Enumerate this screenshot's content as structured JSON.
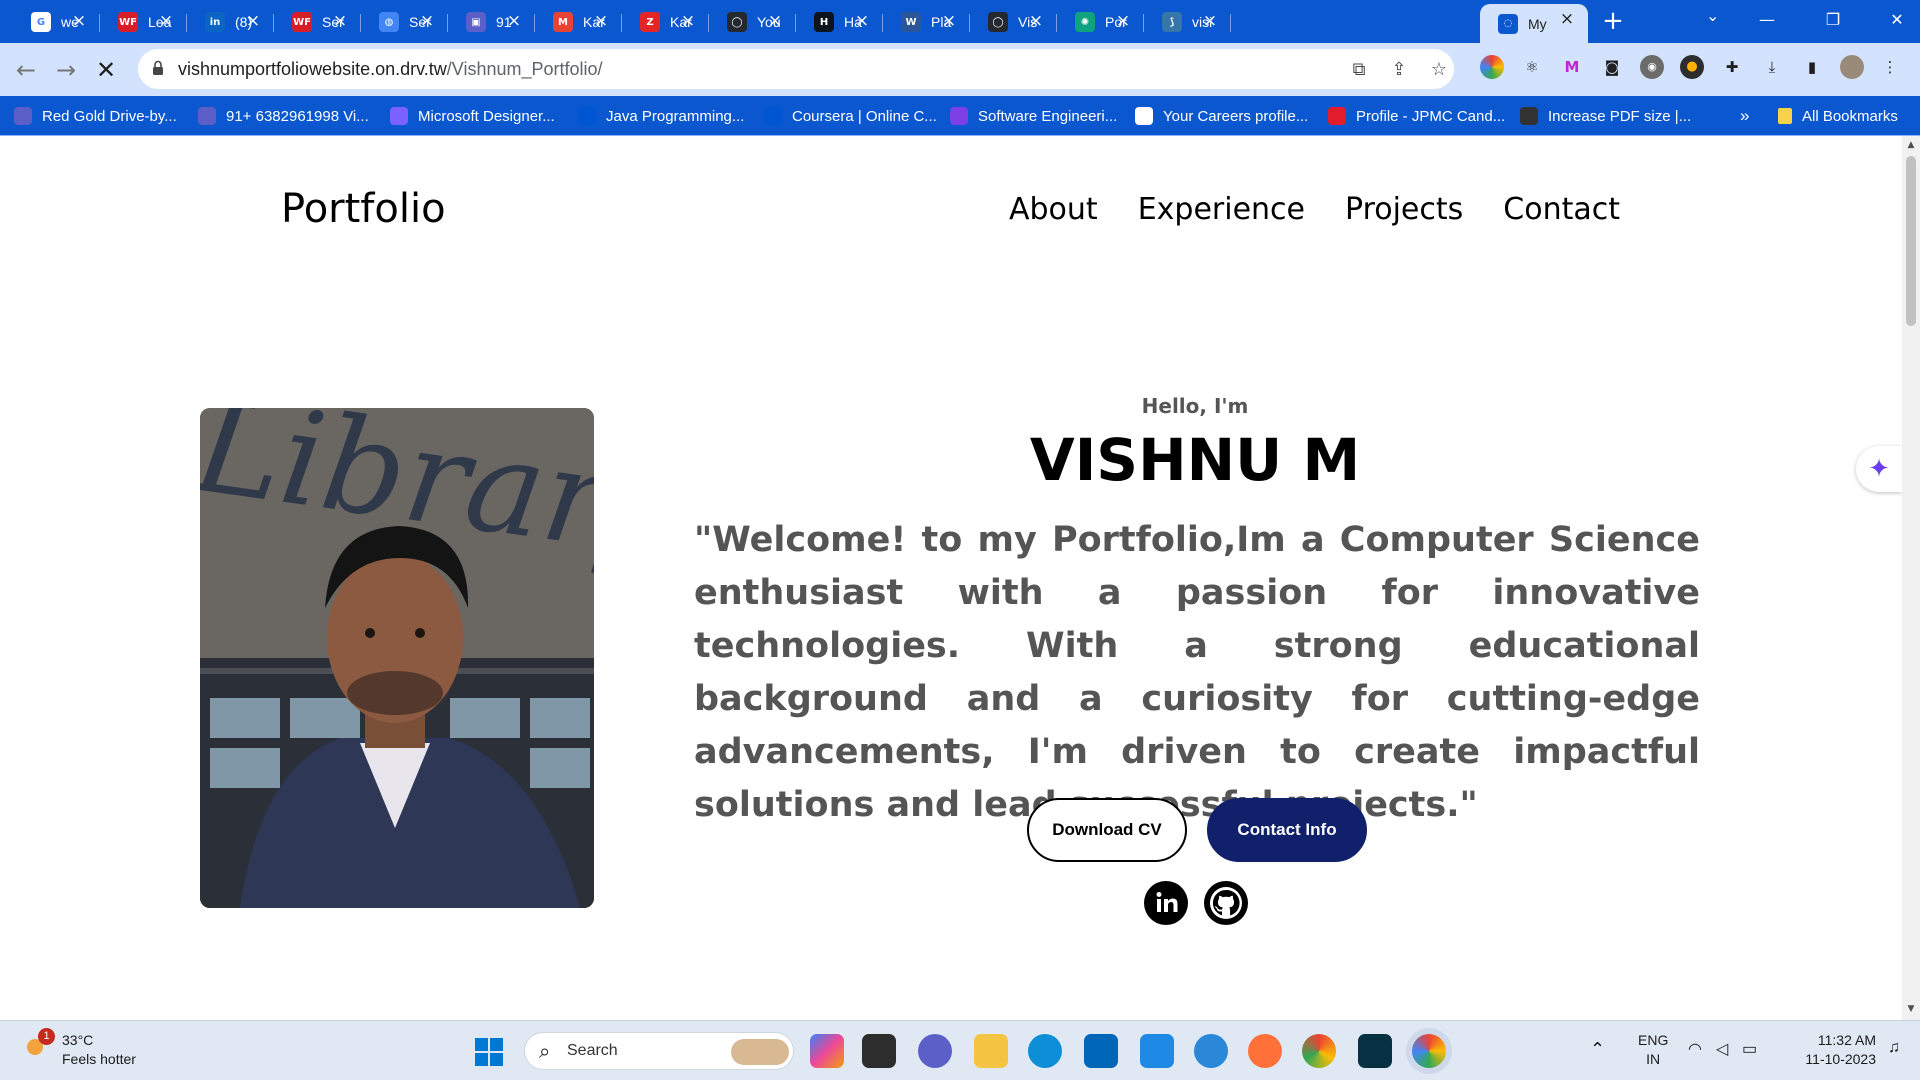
{
  "browser": {
    "tabs": [
      {
        "label": "we",
        "icon": "google-icon",
        "color": "#ffffff"
      },
      {
        "label": "Lea",
        "icon": "wf-icon",
        "color": "#d71e28"
      },
      {
        "label": "(8)",
        "icon": "linkedin-icon",
        "color": "#0a66c2"
      },
      {
        "label": "Ser",
        "icon": "wf-icon",
        "color": "#d71e28"
      },
      {
        "label": "Ser",
        "icon": "globe-icon",
        "color": "#4285f4"
      },
      {
        "label": "91",
        "icon": "app-icon",
        "color": "#5b5fc7"
      },
      {
        "label": "Kar",
        "icon": "gmail-icon",
        "color": "#ea4335"
      },
      {
        "label": "Kar",
        "icon": "zoho-icon",
        "color": "#e42527"
      },
      {
        "label": "You",
        "icon": "github-icon",
        "color": "#24292f"
      },
      {
        "label": "Ha",
        "icon": "hackerrank-icon",
        "color": "#0e141e"
      },
      {
        "label": "Pla",
        "icon": "word-icon",
        "color": "#2b579a"
      },
      {
        "label": "Vis",
        "icon": "github-icon",
        "color": "#24292f"
      },
      {
        "label": "Por",
        "icon": "openai-icon",
        "color": "#10a37f"
      },
      {
        "label": "visi",
        "icon": "python-icon",
        "color": "#3776ab"
      },
      {
        "label": "My",
        "icon": "loading-icon",
        "color": "#0b57d0",
        "active": true
      }
    ],
    "new_tab": "+",
    "window_controls": {
      "minimize": "—",
      "restore": "❐",
      "close": "✕"
    },
    "url_host": "vishnumportfoliowebsite.on.drv.tw",
    "url_path": "/Vishnum_Portfolio/",
    "bookmarks": [
      {
        "label": "Red Gold Drive-by...",
        "color": "#5b5fc7"
      },
      {
        "label": "91+ 6382961998 Vi...",
        "color": "#5b5fc7"
      },
      {
        "label": "Microsoft Designer...",
        "color": "#7b61ff"
      },
      {
        "label": "Java Programming...",
        "color": "#0056d2"
      },
      {
        "label": "Coursera | Online C...",
        "color": "#0056d2"
      },
      {
        "label": "Software Engineeri...",
        "color": "#7b3fe4"
      },
      {
        "label": "Your Careers profile...",
        "color": "#ffffff"
      },
      {
        "label": "Profile - JPMC Cand...",
        "color": "#e11d2b"
      },
      {
        "label": "Increase PDF size |...",
        "color": "#333333"
      }
    ],
    "bookmarks_overflow": "»",
    "all_bookmarks": "All Bookmarks"
  },
  "site": {
    "logo": "Portfolio",
    "nav": [
      "About",
      "Experience",
      "Projects",
      "Contact"
    ],
    "hello": "Hello, I'm",
    "name": "VISHNU M",
    "intro": "\"Welcome! to my Portfolio,Im a Computer Science enthusiast with a passion for innovative technologies. With a strong educational background and a curiosity for cutting-edge advancements, I'm driven to create impactful solutions and lead successful projects.\"",
    "buttons": {
      "download_cv": "Download CV",
      "contact_info": "Contact Info"
    },
    "social": [
      "linkedin-icon",
      "github-icon"
    ],
    "photo_sign_text": "Library",
    "accent": "#10206b"
  },
  "taskbar": {
    "weather_temp": "33°C",
    "weather_desc": "Feels hotter",
    "weather_badge": "1",
    "search_placeholder": "Search",
    "language": "ENG",
    "region": "IN",
    "time": "11:32 AM",
    "date": "11-10-2023"
  }
}
